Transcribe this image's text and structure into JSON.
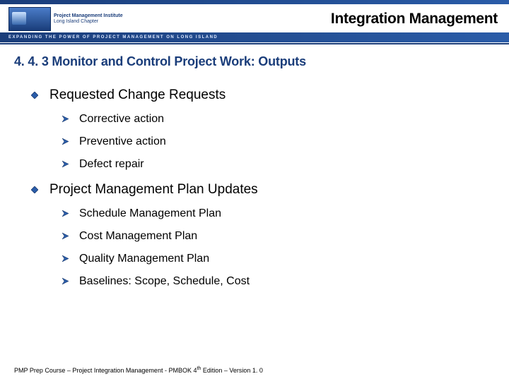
{
  "header": {
    "org_line1": "Project Management Institute",
    "org_line2": "Long Island Chapter",
    "title": "Integration Management",
    "tagline": "EXPANDING THE POWER OF PROJECT MANAGEMENT ON LONG ISLAND"
  },
  "section_title": "4. 4. 3 Monitor and Control Project Work: Outputs",
  "bullets": [
    {
      "text": "Requested Change Requests",
      "subs": [
        "Corrective action",
        "Preventive action",
        "Defect repair"
      ]
    },
    {
      "text": "Project Management Plan Updates",
      "subs": [
        "Schedule Management Plan",
        "Cost Management Plan",
        "Quality Management Plan",
        "Baselines: Scope, Schedule, Cost"
      ]
    }
  ],
  "footer": {
    "text_a": "PMP Prep Course – Project Integration Management - PMBOK 4",
    "text_sup": "th",
    "text_b": " Edition – Version 1. 0"
  }
}
